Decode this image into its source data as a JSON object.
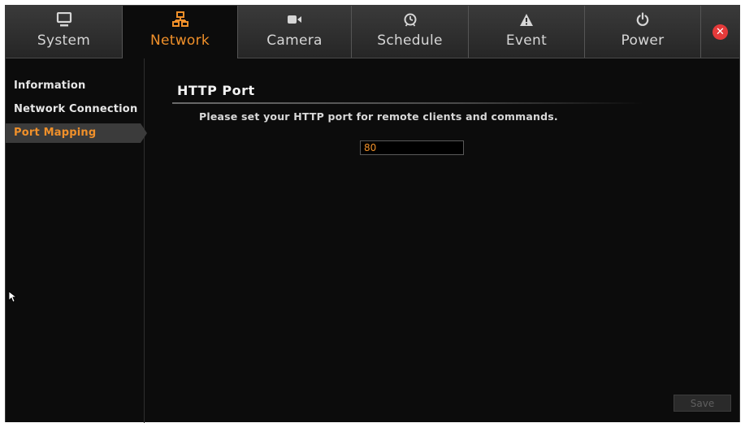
{
  "tabs": [
    {
      "label": "System",
      "icon": "monitor-icon"
    },
    {
      "label": "Network",
      "icon": "network-icon"
    },
    {
      "label": "Camera",
      "icon": "camera-icon"
    },
    {
      "label": "Schedule",
      "icon": "schedule-icon"
    },
    {
      "label": "Event",
      "icon": "warning-icon"
    },
    {
      "label": "Power",
      "icon": "power-icon"
    }
  ],
  "active_tab": "Network",
  "close_icon": "close-icon",
  "sidebar": {
    "items": [
      {
        "label": "Information"
      },
      {
        "label": "Network Connection"
      },
      {
        "label": "Port Mapping"
      }
    ],
    "active_item": "Port Mapping"
  },
  "content": {
    "title": "HTTP Port",
    "description": "Please set your HTTP port for remote clients and commands.",
    "port_value": "80",
    "save_label": "Save"
  },
  "colors": {
    "accent": "#f0902a",
    "background": "#0c0c0c",
    "close": "#e53a3a"
  }
}
